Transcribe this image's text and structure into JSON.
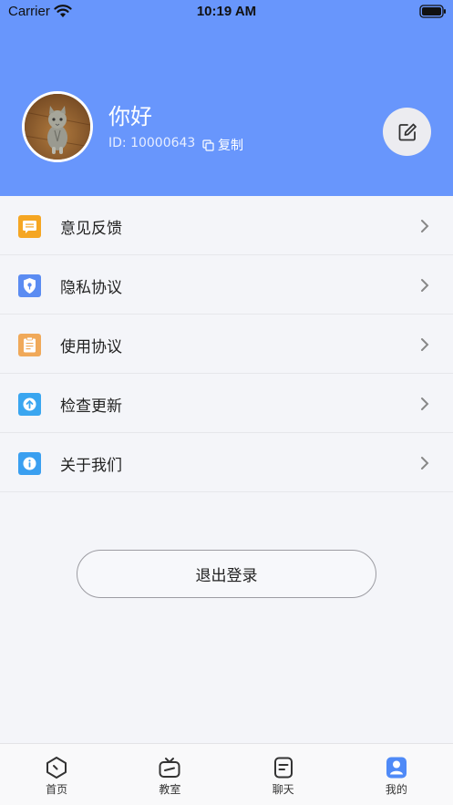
{
  "status_bar": {
    "carrier": "Carrier",
    "time": "10:19 AM"
  },
  "profile": {
    "name": "你好",
    "id_text": "ID: 10000643",
    "copy_label": "复制"
  },
  "menu": {
    "items": [
      {
        "label": "意见反馈",
        "icon": "feedback-icon",
        "color": "#f5a623"
      },
      {
        "label": "隐私协议",
        "icon": "privacy-shield-icon",
        "color": "#5b8cf2"
      },
      {
        "label": "使用协议",
        "icon": "clipboard-icon",
        "color": "#f0a95a"
      },
      {
        "label": "检查更新",
        "icon": "update-arrow-icon",
        "color": "#3aa6f0"
      },
      {
        "label": "关于我们",
        "icon": "info-icon",
        "color": "#3a9ff0"
      }
    ]
  },
  "logout_label": "退出登录",
  "tabbar": {
    "tabs": [
      {
        "label": "首页",
        "icon": "home-icon"
      },
      {
        "label": "教室",
        "icon": "tv-icon"
      },
      {
        "label": "聊天",
        "icon": "chat-icon"
      },
      {
        "label": "我的",
        "icon": "profile-icon",
        "active": true
      }
    ]
  },
  "colors": {
    "header": "#6896fc",
    "accent": "#4f8af7"
  }
}
